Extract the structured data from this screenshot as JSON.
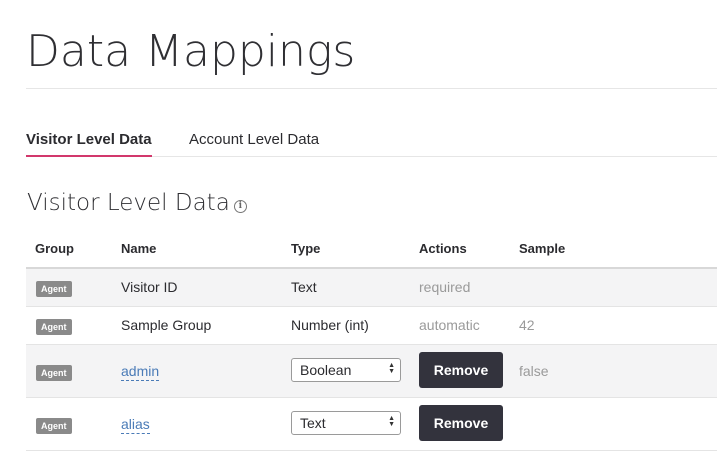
{
  "page": {
    "title": "Data Mappings"
  },
  "tabs": [
    {
      "label": "Visitor Level Data",
      "active": true
    },
    {
      "label": "Account Level Data",
      "active": false
    }
  ],
  "section": {
    "title": "Visitor Level Data",
    "info_icon": "info-icon"
  },
  "table": {
    "headers": [
      "Group",
      "Name",
      "Type",
      "Actions",
      "Sample"
    ],
    "rows": [
      {
        "group": "Agent",
        "name": "Visitor ID",
        "type": "Text",
        "action": "required",
        "sample": ""
      },
      {
        "group": "Agent",
        "name": "Sample Group",
        "type": "Number (int)",
        "action": "automatic",
        "sample": "42"
      },
      {
        "group": "Agent",
        "name": "admin",
        "type": "Boolean",
        "action": "Remove",
        "sample": "false"
      },
      {
        "group": "Agent",
        "name": "alias",
        "type": "Text",
        "action": "Remove",
        "sample": ""
      }
    ]
  },
  "colors": {
    "accent": "#d2386c",
    "button": "#33333d",
    "link": "#4a7bb7",
    "badge": "#8a8a8a"
  }
}
